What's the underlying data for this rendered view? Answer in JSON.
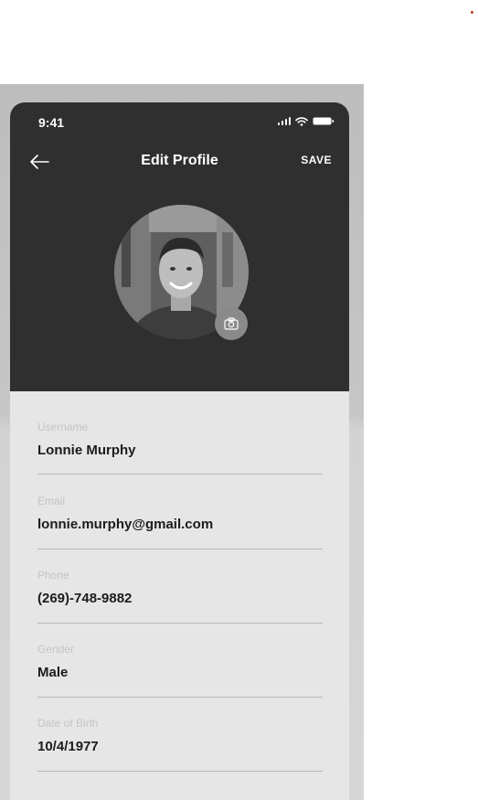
{
  "status_bar": {
    "time": "9:41"
  },
  "header": {
    "title": "Edit Profile",
    "save_label": "SAVE"
  },
  "icons": {
    "back": "arrow-left-icon",
    "camera": "camera-icon",
    "signal": "signal-icon",
    "wifi": "wifi-icon",
    "battery": "battery-icon"
  },
  "form": {
    "fields": [
      {
        "label": "Username",
        "value": "Lonnie Murphy"
      },
      {
        "label": "Email",
        "value": "lonnie.murphy@gmail.com"
      },
      {
        "label": "Phone",
        "value": "(269)-748-9882"
      },
      {
        "label": "Gender",
        "value": "Male"
      },
      {
        "label": "Date of Birth",
        "value": "10/4/1977"
      }
    ]
  },
  "colors": {
    "header_bg": "#2f2f2f",
    "body_bg": "#e6e6e6",
    "label": "#c4c4c4",
    "value": "#1c1c1c"
  }
}
